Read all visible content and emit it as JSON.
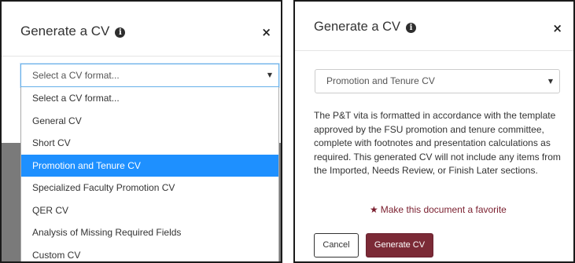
{
  "left_modal": {
    "title": "Generate a CV",
    "info_glyph": "i",
    "close_glyph": "×",
    "select": {
      "value": "Select a CV format...",
      "arrow": "▼"
    },
    "options": [
      "Select a CV format...",
      "General CV",
      "Short CV",
      "Promotion and Tenure CV",
      "Specialized Faculty Promotion CV",
      "QER CV",
      "Analysis of Missing Required Fields",
      "Custom CV"
    ],
    "selected_index": 3
  },
  "right_modal": {
    "title": "Generate a CV",
    "info_glyph": "i",
    "close_glyph": "×",
    "select": {
      "value": "Promotion and Tenure CV",
      "arrow": "▼"
    },
    "description": "The P&T vita is formatted in accordance with the template approved by the FSU promotion and tenure committee, complete with footnotes and presentation calculations as required. This generated CV will not include any items from the Imported, Needs Review, or Finish Later sections.",
    "favorite": {
      "glyph": "★",
      "label": "Make this document a favorite"
    },
    "buttons": {
      "cancel": "Cancel",
      "generate": "Generate CV"
    }
  },
  "colors": {
    "accent": "#7b2a36",
    "highlight": "#1e90ff",
    "focus_border": "#66afe9",
    "backdrop": "#7a7a7a"
  },
  "icons": {
    "info": "info-circle-icon",
    "close": "close-icon",
    "dropdown": "chevron-down-icon",
    "favorite": "star-icon"
  }
}
